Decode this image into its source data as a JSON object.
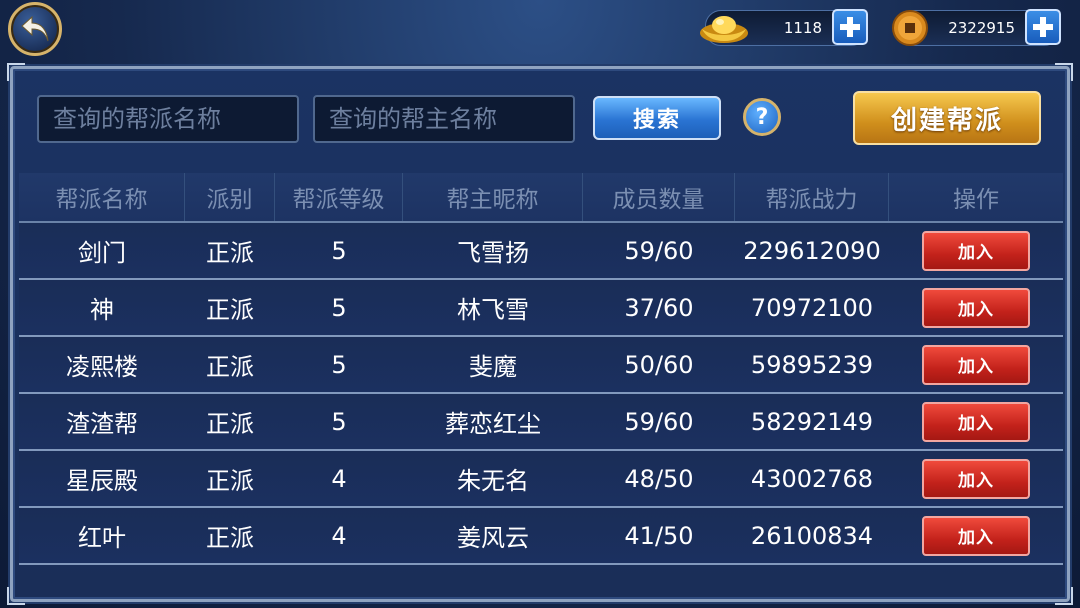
{
  "currency": {
    "gold": "1118",
    "coins": "2322915"
  },
  "search": {
    "guild_name_placeholder": "查询的帮派名称",
    "leader_name_placeholder": "查询的帮主名称",
    "search_label": "搜索",
    "help_label": "?",
    "create_label": "创建帮派"
  },
  "table": {
    "headers": [
      "帮派名称",
      "派别",
      "帮派等级",
      "帮主昵称",
      "成员数量",
      "帮派战力",
      "操作"
    ],
    "rows": [
      {
        "name": "剑门",
        "faction": "正派",
        "level": "5",
        "leader": "飞雪扬",
        "members": "59/60",
        "power": "229612090",
        "action": "加入"
      },
      {
        "name": "神",
        "faction": "正派",
        "level": "5",
        "leader": "林飞雪",
        "members": "37/60",
        "power": "70972100",
        "action": "加入"
      },
      {
        "name": "凌熙楼",
        "faction": "正派",
        "level": "5",
        "leader": "斐魔",
        "members": "50/60",
        "power": "59895239",
        "action": "加入"
      },
      {
        "name": "渣渣帮",
        "faction": "正派",
        "level": "5",
        "leader": "葬恋红尘",
        "members": "59/60",
        "power": "58292149",
        "action": "加入"
      },
      {
        "name": "星辰殿",
        "faction": "正派",
        "level": "4",
        "leader": "朱无名",
        "members": "48/50",
        "power": "43002768",
        "action": "加入"
      },
      {
        "name": "红叶",
        "faction": "正派",
        "level": "4",
        "leader": "姜风云",
        "members": "41/50",
        "power": "26100834",
        "action": "加入"
      }
    ]
  },
  "colors": {
    "accent_gold": "#d7b46a",
    "join_red": "#c3221b",
    "search_blue": "#2a74d3",
    "create_orange": "#d08f1c"
  }
}
